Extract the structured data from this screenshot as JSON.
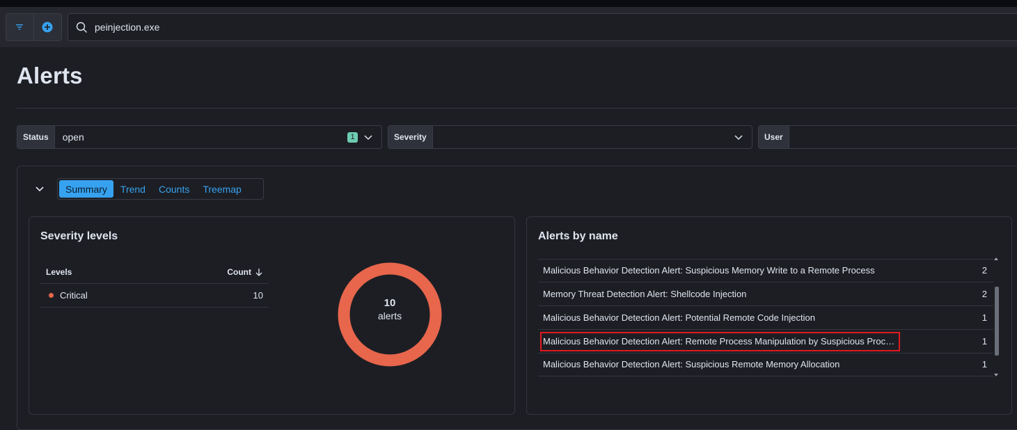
{
  "topbar": {
    "filter_icon": "filter-icon",
    "add_icon": "plus-circle-icon",
    "search_icon": "search-icon",
    "query": "peinjection.exe"
  },
  "page": {
    "title": "Alerts"
  },
  "filters": [
    {
      "label": "Status",
      "value": "open",
      "badge": "1"
    },
    {
      "label": "Severity",
      "value": ""
    },
    {
      "label": "User",
      "value": ""
    }
  ],
  "tabs": [
    "Summary",
    "Trend",
    "Counts",
    "Treemap"
  ],
  "active_tab": "Summary",
  "severity": {
    "title": "Severity levels",
    "col_levels": "Levels",
    "col_count": "Count",
    "sort_icon": "arrow-down-icon",
    "rows": [
      {
        "level": "Critical",
        "count": "10",
        "color": "#e7664c"
      }
    ],
    "donut_total": "10",
    "donut_label": "alerts"
  },
  "alerts_by_name": {
    "title": "Alerts by name",
    "rows": [
      {
        "name": "Malicious Behavior Detection Alert: Suspicious Memory Write to a Remote Process",
        "count": "2"
      },
      {
        "name": "Memory Threat Detection Alert: Shellcode Injection",
        "count": "2"
      },
      {
        "name": "Malicious Behavior Detection Alert: Potential Remote Code Injection",
        "count": "1"
      },
      {
        "name": "Malicious Behavior Detection Alert: Remote Process Manipulation by Suspicious Proc…",
        "count": "1"
      },
      {
        "name": "Malicious Behavior Detection Alert: Suspicious Remote Memory Allocation",
        "count": "1"
      }
    ]
  },
  "colors": {
    "accent": "#36a2ef",
    "critical": "#e7664c",
    "badge": "#6dccb1",
    "highlight": "#e0191f"
  }
}
